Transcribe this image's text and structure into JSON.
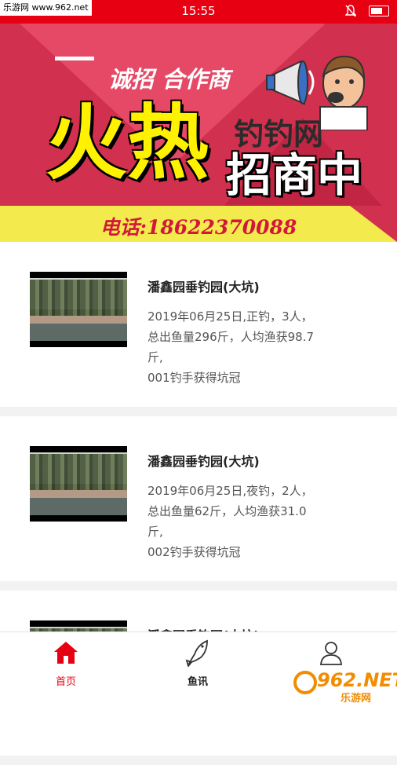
{
  "status_bar": {
    "watermark": "乐游网 www.962.net",
    "time": "15:55",
    "icons": [
      "bell-off-icon",
      "battery-charging-icon"
    ]
  },
  "banner": {
    "slogan": "诚招 合作商",
    "headline": "火热",
    "site_name": "钓钓网",
    "recruit": "招商中",
    "phone": "电话:18622370088"
  },
  "catches": [
    {
      "name": "潘鑫园垂钓园(大坑)",
      "desc_lines": [
        "2019年06月25日,正钓，3人，",
        "总出鱼量296斤，人均渔获98.7",
        "斤,",
        "001钓手获得坑冠"
      ]
    },
    {
      "name": "潘鑫园垂钓园(大坑)",
      "desc_lines": [
        "2019年06月25日,夜钓，2人，",
        "总出鱼量62斤，人均渔获31.0",
        "斤,",
        "002钓手获得坑冠"
      ]
    },
    {
      "name": "潘鑫园垂钓园(大坑)",
      "desc_lines": []
    }
  ],
  "tabbar": {
    "home_label": "首页",
    "news_label": "鱼讯",
    "active_color": "#e60012"
  },
  "watermark_bottom": {
    "logo": "962.NET",
    "text": "乐游网"
  },
  "colors": {
    "brand_red": "#e60012",
    "banner_pink": "#d2304f",
    "phone_bar_yellow": "#f3ea4d"
  }
}
